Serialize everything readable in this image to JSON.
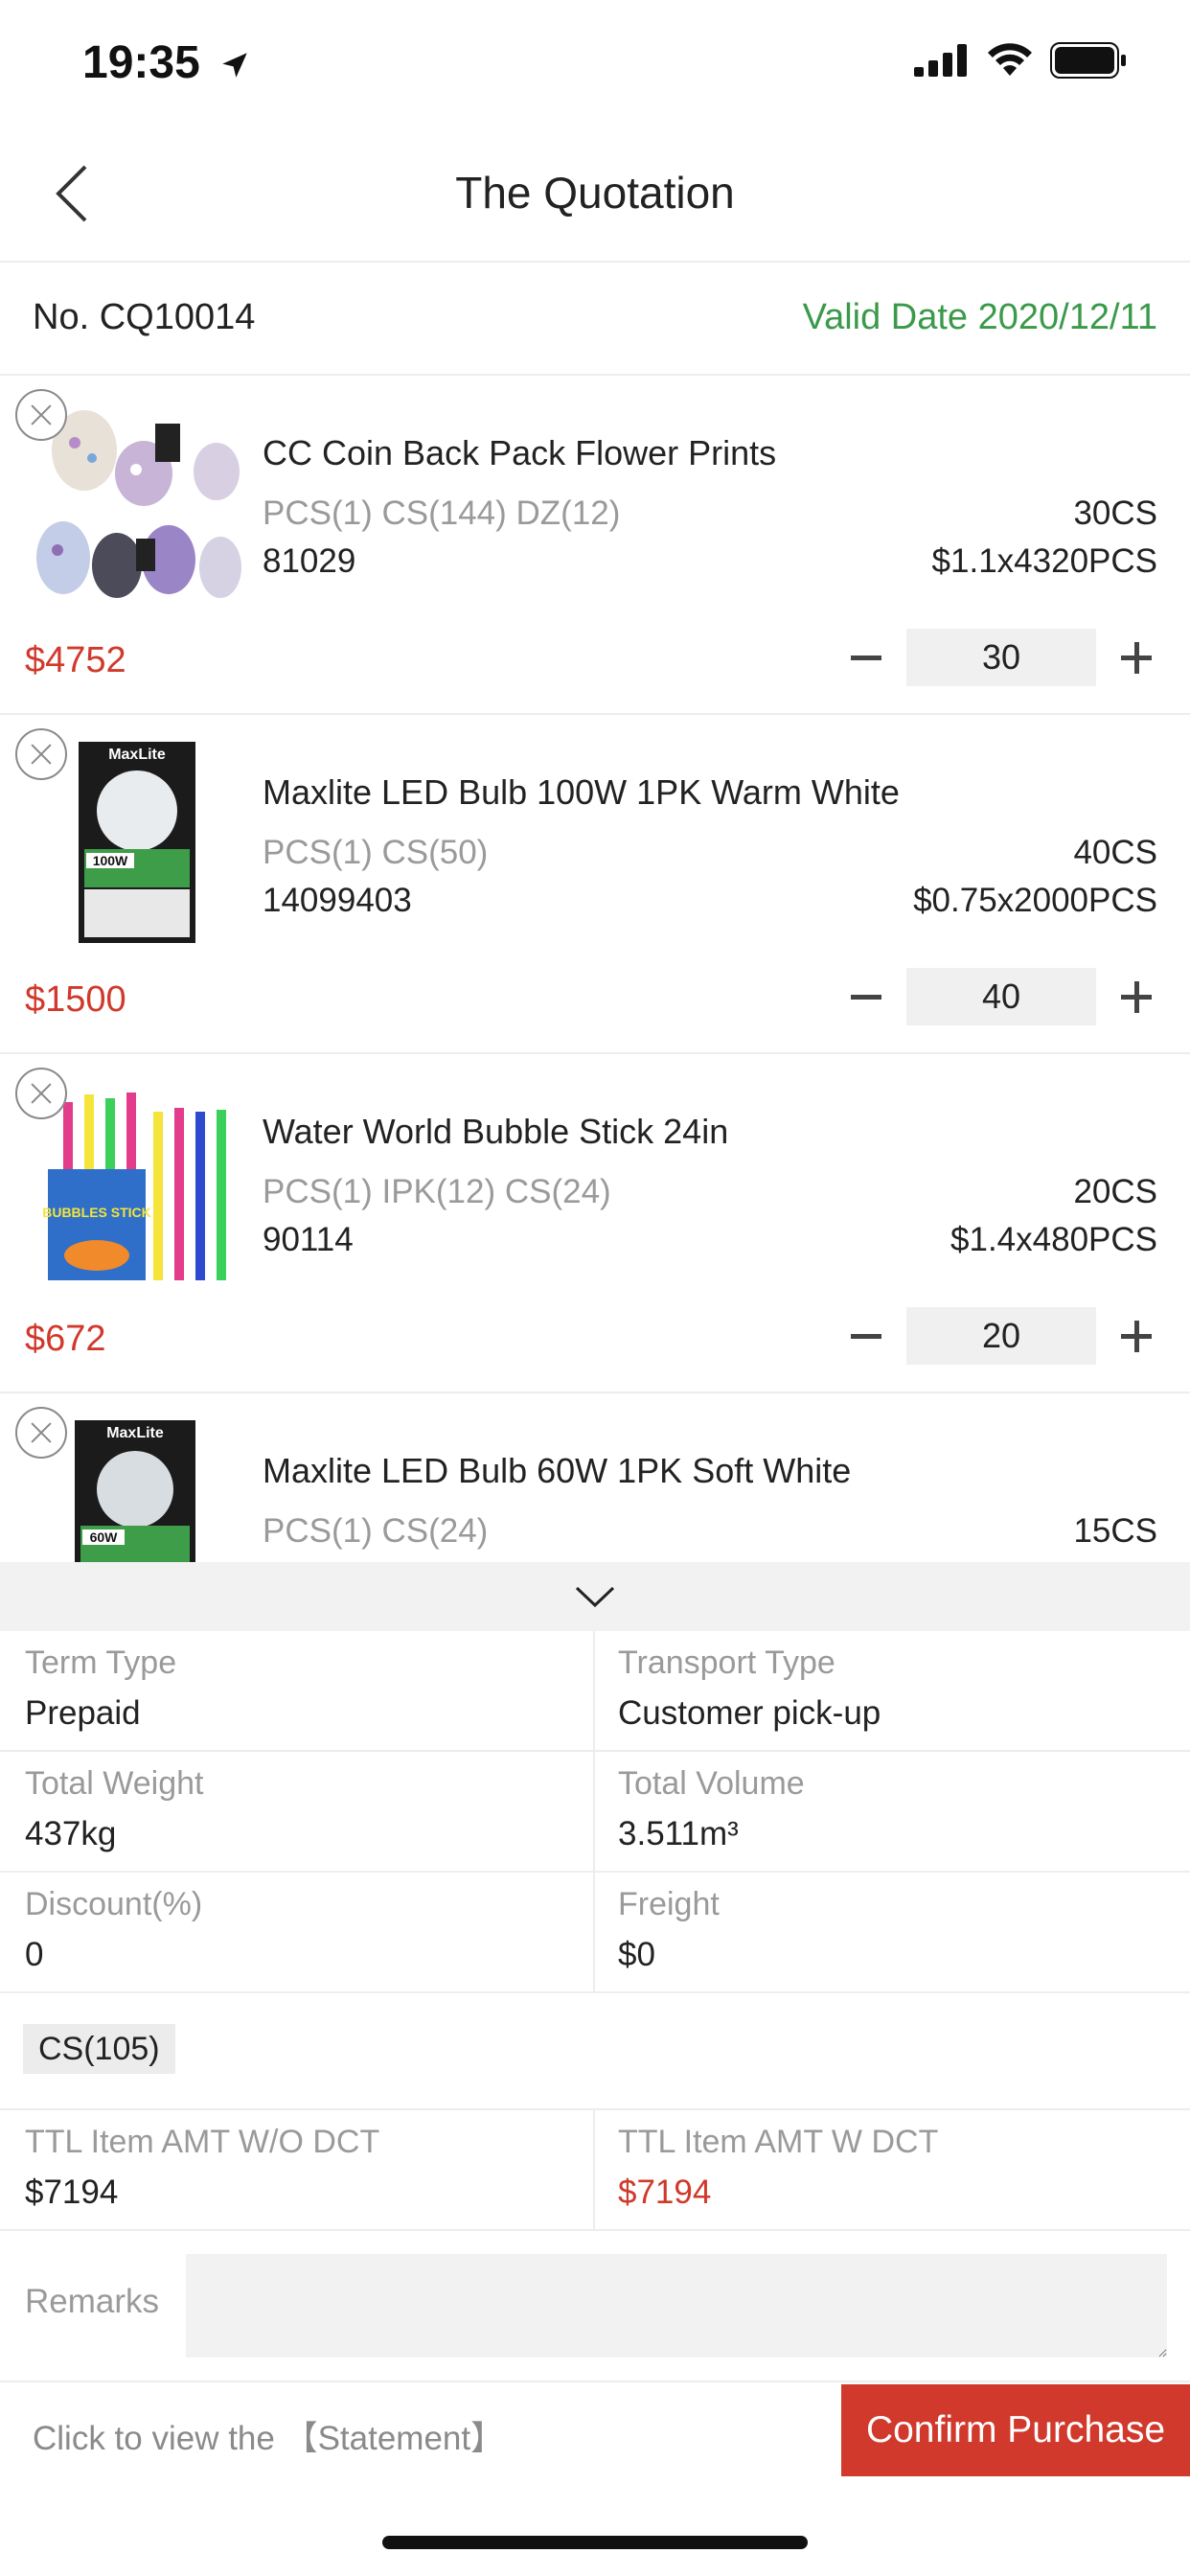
{
  "status_bar": {
    "time": "19:35"
  },
  "nav": {
    "title": "The Quotation"
  },
  "quote": {
    "number": "No. CQ10014",
    "valid_date": "Valid Date 2020/12/11"
  },
  "items": [
    {
      "name": "CC Coin Back Pack Flower Prints",
      "units": "PCS(1)  CS(144)  DZ(12)",
      "qty": "30CS",
      "code": "81029",
      "price_calc": "$1.1x4320PCS",
      "total": "$4752",
      "stepper_value": "30"
    },
    {
      "name": "Maxlite LED Bulb 100W 1PK Warm White",
      "units": "PCS(1)  CS(50)",
      "qty": "40CS",
      "code": "14099403",
      "price_calc": "$0.75x2000PCS",
      "total": "$1500",
      "stepper_value": "40"
    },
    {
      "name": "Water World Bubble Stick 24in",
      "units": "PCS(1)  IPK(12)  CS(24)",
      "qty": "20CS",
      "code": "90114",
      "price_calc": "$1.4x480PCS",
      "total": "$672",
      "stepper_value": "20"
    },
    {
      "name": "Maxlite LED Bulb 60W 1PK Soft White",
      "units": "PCS(1)  CS(24)",
      "qty": "15CS",
      "code": "",
      "price_calc": "",
      "total": "",
      "stepper_value": ""
    }
  ],
  "thumb_labels": {
    "maxlite_brand": "MaxLite",
    "w100": "100W",
    "w60": "60W",
    "bubbles": "BUBBLES STICK"
  },
  "details": {
    "term_type_label": "Term Type",
    "term_type_value": "Prepaid",
    "transport_type_label": "Transport Type",
    "transport_type_value": "Customer pick-up",
    "total_weight_label": "Total Weight",
    "total_weight_value": "437kg",
    "total_volume_label": "Total Volume",
    "total_volume_value": "3.511m³",
    "discount_label": "Discount(%)",
    "discount_value": "0",
    "freight_label": "Freight",
    "freight_value": "$0",
    "unit_summary": "CS(105)",
    "ttl_wo_dct_label": "TTL Item AMT W/O DCT",
    "ttl_wo_dct_value": "$7194",
    "ttl_w_dct_label": "TTL Item AMT W DCT",
    "ttl_w_dct_value": "$7194",
    "remarks_label": "Remarks",
    "remarks_value": ""
  },
  "footer": {
    "statement_link": "Click to view the 【Statement】",
    "confirm_label": "Confirm Purchase"
  },
  "colors": {
    "accent_red": "#d0392b",
    "valid_green": "#3a9a4a"
  }
}
